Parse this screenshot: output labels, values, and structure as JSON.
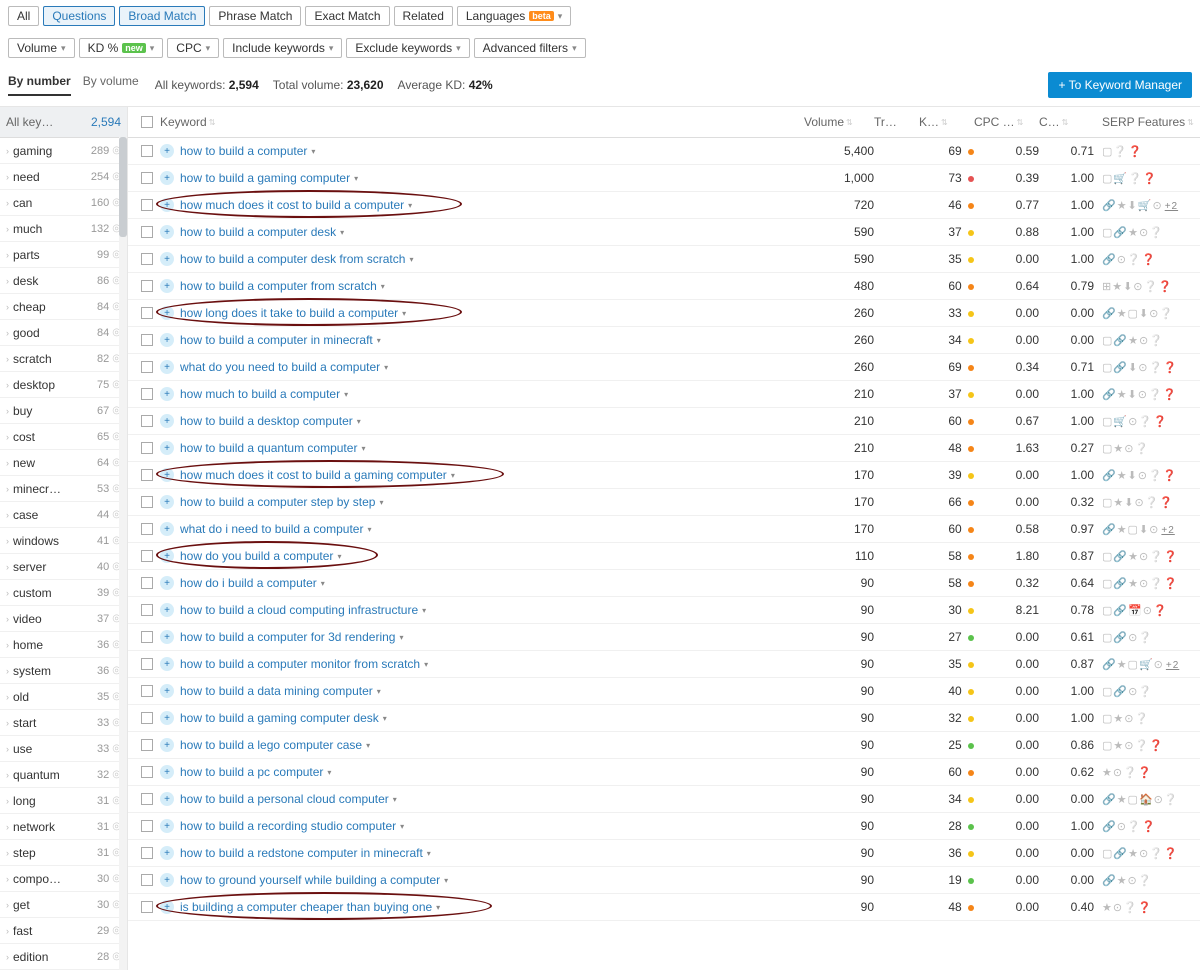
{
  "toolbar1": {
    "all": "All",
    "questions": "Questions",
    "broad": "Broad Match",
    "phrase": "Phrase Match",
    "exact": "Exact Match",
    "related": "Related",
    "languages": "Languages",
    "beta": "beta"
  },
  "toolbar2": {
    "volume": "Volume",
    "kd": "KD %",
    "new": "new",
    "cpc": "CPC",
    "include": "Include keywords",
    "exclude": "Exclude keywords",
    "advanced": "Advanced filters"
  },
  "tabs": {
    "by_number": "By number",
    "by_volume": "By volume"
  },
  "stats": {
    "all_kw_label": "All keywords:",
    "all_kw_value": "2,594",
    "tot_vol_label": "Total volume:",
    "tot_vol_value": "23,620",
    "avg_kd_label": "Average KD:",
    "avg_kd_value": "42%"
  },
  "cta": "+ To Keyword Manager",
  "sidebar": {
    "head_label": "All key…",
    "head_count": "2,594",
    "items": [
      {
        "label": "gaming",
        "count": "289"
      },
      {
        "label": "need",
        "count": "254"
      },
      {
        "label": "can",
        "count": "160"
      },
      {
        "label": "much",
        "count": "132"
      },
      {
        "label": "parts",
        "count": "99"
      },
      {
        "label": "desk",
        "count": "86"
      },
      {
        "label": "cheap",
        "count": "84"
      },
      {
        "label": "good",
        "count": "84"
      },
      {
        "label": "scratch",
        "count": "82"
      },
      {
        "label": "desktop",
        "count": "75"
      },
      {
        "label": "buy",
        "count": "67"
      },
      {
        "label": "cost",
        "count": "65"
      },
      {
        "label": "new",
        "count": "64"
      },
      {
        "label": "minecr…",
        "count": "53"
      },
      {
        "label": "case",
        "count": "44"
      },
      {
        "label": "windows",
        "count": "41"
      },
      {
        "label": "server",
        "count": "40"
      },
      {
        "label": "custom",
        "count": "39"
      },
      {
        "label": "video",
        "count": "37"
      },
      {
        "label": "home",
        "count": "36"
      },
      {
        "label": "system",
        "count": "36"
      },
      {
        "label": "old",
        "count": "35"
      },
      {
        "label": "start",
        "count": "33"
      },
      {
        "label": "use",
        "count": "33"
      },
      {
        "label": "quantum",
        "count": "32"
      },
      {
        "label": "long",
        "count": "31"
      },
      {
        "label": "network",
        "count": "31"
      },
      {
        "label": "step",
        "count": "31"
      },
      {
        "label": "compo…",
        "count": "30"
      },
      {
        "label": "get",
        "count": "30"
      },
      {
        "label": "fast",
        "count": "29"
      },
      {
        "label": "edition",
        "count": "28"
      }
    ]
  },
  "headers": {
    "keyword": "Keyword",
    "volume": "Volume",
    "trend": "Tr…",
    "kd": "K…",
    "cpc": "CPC …",
    "comp": "C…",
    "serp": "SERP Features"
  },
  "rows": [
    {
      "kw": "how to build a computer",
      "vol": "5,400",
      "kd": 69,
      "kdc": "orange",
      "cpc": "0.59",
      "comp": "0.71",
      "serp": "▢❔❓",
      "circled": false
    },
    {
      "kw": "how to build a gaming computer",
      "vol": "1,000",
      "kd": 73,
      "kdc": "red",
      "cpc": "0.39",
      "comp": "1.00",
      "serp": "▢🛒❔❓",
      "circled": false
    },
    {
      "kw": "how much does it cost to build a computer",
      "vol": "720",
      "kd": 46,
      "kdc": "orange",
      "cpc": "0.77",
      "comp": "1.00",
      "serp": "🔗★⬇🛒⊙",
      "extra": "+2",
      "circled": true
    },
    {
      "kw": "how to build a computer desk",
      "vol": "590",
      "kd": 37,
      "kdc": "yellow",
      "cpc": "0.88",
      "comp": "1.00",
      "serp": "▢🔗★⊙❔",
      "circled": false
    },
    {
      "kw": "how to build a computer desk from scratch",
      "vol": "590",
      "kd": 35,
      "kdc": "yellow",
      "cpc": "0.00",
      "comp": "1.00",
      "serp": "🔗⊙❔❓",
      "circled": false
    },
    {
      "kw": "how to build a computer from scratch",
      "vol": "480",
      "kd": 60,
      "kdc": "orange",
      "cpc": "0.64",
      "comp": "0.79",
      "serp": "⊞★⬇⊙❔❓",
      "circled": false
    },
    {
      "kw": "how long does it take to build a computer",
      "vol": "260",
      "kd": 33,
      "kdc": "yellow",
      "cpc": "0.00",
      "comp": "0.00",
      "serp": "🔗★▢⬇⊙❔",
      "circled": true
    },
    {
      "kw": "how to build a computer in minecraft",
      "vol": "260",
      "kd": 34,
      "kdc": "yellow",
      "cpc": "0.00",
      "comp": "0.00",
      "serp": "▢🔗★⊙❔",
      "circled": false
    },
    {
      "kw": "what do you need to build a computer",
      "vol": "260",
      "kd": 69,
      "kdc": "orange",
      "cpc": "0.34",
      "comp": "0.71",
      "serp": "▢🔗⬇⊙❔❓",
      "circled": false
    },
    {
      "kw": "how much to build a computer",
      "vol": "210",
      "kd": 37,
      "kdc": "yellow",
      "cpc": "0.00",
      "comp": "1.00",
      "serp": "🔗★⬇⊙❔❓",
      "circled": false
    },
    {
      "kw": "how to build a desktop computer",
      "vol": "210",
      "kd": 60,
      "kdc": "orange",
      "cpc": "0.67",
      "comp": "1.00",
      "serp": "▢🛒⊙❔❓",
      "circled": false
    },
    {
      "kw": "how to build a quantum computer",
      "vol": "210",
      "kd": 48,
      "kdc": "orange",
      "cpc": "1.63",
      "comp": "0.27",
      "serp": "▢★⊙❔",
      "circled": false
    },
    {
      "kw": "how much does it cost to build a gaming computer",
      "vol": "170",
      "kd": 39,
      "kdc": "yellow",
      "cpc": "0.00",
      "comp": "1.00",
      "serp": "🔗★⬇⊙❔❓",
      "circled": true
    },
    {
      "kw": "how to build a computer step by step",
      "vol": "170",
      "kd": 66,
      "kdc": "orange",
      "cpc": "0.00",
      "comp": "0.32",
      "serp": "▢★⬇⊙❔❓",
      "circled": false
    },
    {
      "kw": "what do i need to build a computer",
      "vol": "170",
      "kd": 60,
      "kdc": "orange",
      "cpc": "0.58",
      "comp": "0.97",
      "serp": "🔗★▢⬇⊙",
      "extra": "+2",
      "circled": false
    },
    {
      "kw": "how do you build a computer",
      "vol": "110",
      "kd": 58,
      "kdc": "orange",
      "cpc": "1.80",
      "comp": "0.87",
      "serp": "▢🔗★⊙❔❓",
      "circled": true
    },
    {
      "kw": "how do i build a computer",
      "vol": "90",
      "kd": 58,
      "kdc": "orange",
      "cpc": "0.32",
      "comp": "0.64",
      "serp": "▢🔗★⊙❔❓",
      "circled": false
    },
    {
      "kw": "how to build a cloud computing infrastructure",
      "vol": "90",
      "kd": 30,
      "kdc": "yellow",
      "cpc": "8.21",
      "comp": "0.78",
      "serp": "▢🔗📅⊙❓",
      "circled": false
    },
    {
      "kw": "how to build a computer for 3d rendering",
      "vol": "90",
      "kd": 27,
      "kdc": "green",
      "cpc": "0.00",
      "comp": "0.61",
      "serp": "▢🔗⊙❔",
      "circled": false
    },
    {
      "kw": "how to build a computer monitor from scratch",
      "vol": "90",
      "kd": 35,
      "kdc": "yellow",
      "cpc": "0.00",
      "comp": "0.87",
      "serp": "🔗★▢🛒⊙",
      "extra": "+2",
      "circled": false
    },
    {
      "kw": "how to build a data mining computer",
      "vol": "90",
      "kd": 40,
      "kdc": "yellow",
      "cpc": "0.00",
      "comp": "1.00",
      "serp": "▢🔗⊙❔",
      "circled": false
    },
    {
      "kw": "how to build a gaming computer desk",
      "vol": "90",
      "kd": 32,
      "kdc": "yellow",
      "cpc": "0.00",
      "comp": "1.00",
      "serp": "▢★⊙❔",
      "circled": false
    },
    {
      "kw": "how to build a lego computer case",
      "vol": "90",
      "kd": 25,
      "kdc": "green",
      "cpc": "0.00",
      "comp": "0.86",
      "serp": "▢★⊙❔❓",
      "circled": false
    },
    {
      "kw": "how to build a pc computer",
      "vol": "90",
      "kd": 60,
      "kdc": "orange",
      "cpc": "0.00",
      "comp": "0.62",
      "serp": "★⊙❔❓",
      "circled": false
    },
    {
      "kw": "how to build a personal cloud computer",
      "vol": "90",
      "kd": 34,
      "kdc": "yellow",
      "cpc": "0.00",
      "comp": "0.00",
      "serp": "🔗★▢🏠⊙❔",
      "circled": false
    },
    {
      "kw": "how to build a recording studio computer",
      "vol": "90",
      "kd": 28,
      "kdc": "green",
      "cpc": "0.00",
      "comp": "1.00",
      "serp": "🔗⊙❔❓",
      "circled": false
    },
    {
      "kw": "how to build a redstone computer in minecraft",
      "vol": "90",
      "kd": 36,
      "kdc": "yellow",
      "cpc": "0.00",
      "comp": "0.00",
      "serp": "▢🔗★⊙❔❓",
      "circled": false
    },
    {
      "kw": "how to ground yourself while building a computer",
      "vol": "90",
      "kd": 19,
      "kdc": "green",
      "cpc": "0.00",
      "comp": "0.00",
      "serp": "🔗★⊙❔",
      "circled": false
    },
    {
      "kw": "is building a computer cheaper than buying one",
      "vol": "90",
      "kd": 48,
      "kdc": "orange",
      "cpc": "0.00",
      "comp": "0.40",
      "serp": "★⊙❔❓",
      "circled": true
    }
  ]
}
